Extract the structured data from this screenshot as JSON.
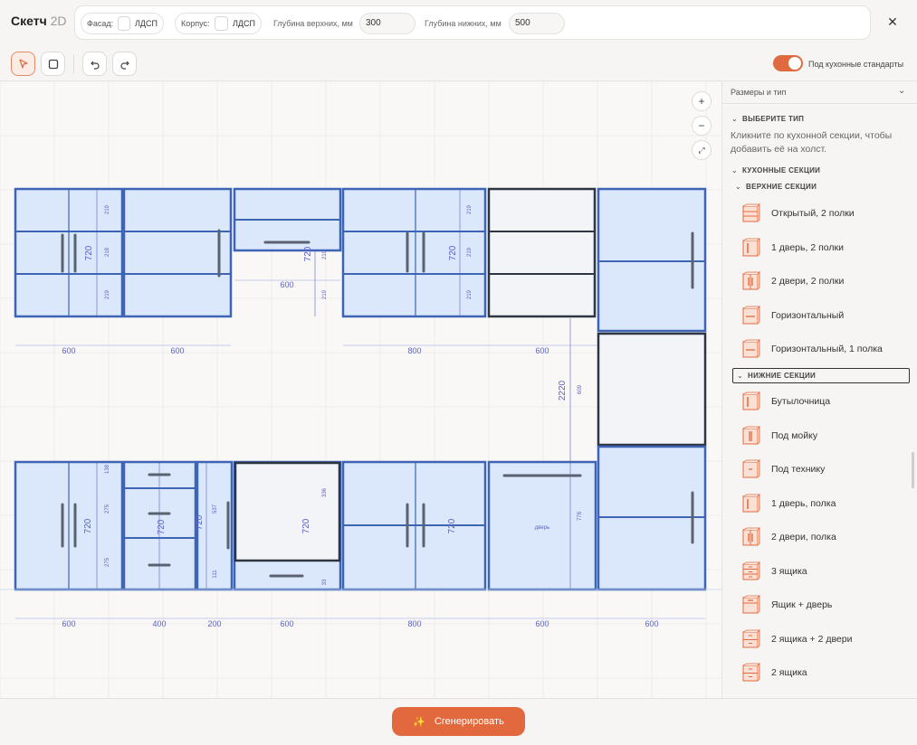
{
  "app": {
    "title": "Скетч",
    "title_suffix": "2D"
  },
  "params": {
    "facade_label": "Фасад:",
    "facade_value": "ЛДСП",
    "body_label": "Корпус:",
    "body_value": "ЛДСП",
    "upper_depth_label": "Глубина верхних, мм",
    "upper_depth_value": "300",
    "lower_depth_label": "Глубина нижних, мм",
    "lower_depth_value": "500"
  },
  "toolbar": {
    "toggle_label": "Под кухонные стандарты",
    "toggle_on": true
  },
  "canvas": {
    "upper_widths": [
      "600",
      "600",
      "600",
      "800",
      "600"
    ],
    "lower_widths": [
      "600",
      "400",
      "200",
      "600",
      "800",
      "600",
      "600"
    ],
    "height_labels": [
      "720",
      "720",
      "720",
      "720",
      "720",
      "720",
      "720",
      "720"
    ],
    "total_height": "2220",
    "shelf_labels": [
      "219",
      "218",
      "219",
      "219",
      "219",
      "219",
      "219",
      "219"
    ],
    "misc_labels": [
      "138",
      "275",
      "275",
      "537",
      "111",
      "336",
      "33",
      "778",
      "609"
    ],
    "door_label": "дверь"
  },
  "sidebar": {
    "header": "Размеры и тип",
    "select_type": "ВЫБЕРИТЕ ТИП",
    "hint": "Кликните по кухонной секции, чтобы добавить её на холст.",
    "kitchen_sections": "КУХОННЫЕ СЕКЦИИ",
    "upper_sections": "ВЕРХНИЕ СЕКЦИИ",
    "upper_items": [
      "Открытый, 2 полки",
      "1 дверь, 2 полки",
      "2 двери, 2 полки",
      "Горизонтальный",
      "Горизонтальный, 1 полка"
    ],
    "lower_sections": "НИЖНИЕ СЕКЦИИ",
    "lower_items": [
      "Бутылочница",
      "Под мойку",
      "Под технику",
      "1 дверь, полка",
      "2 двери, полка",
      "3 ящика",
      "Ящик + дверь",
      "2 ящика + 2 двери",
      "2 ящика"
    ]
  },
  "generate_label": "Сгенерировать",
  "colors": {
    "accent": "#e2693e",
    "cabinet_fill": "#dbe8fb",
    "cabinet_stroke": "#3e64b5",
    "dim": "#5b62c9"
  }
}
